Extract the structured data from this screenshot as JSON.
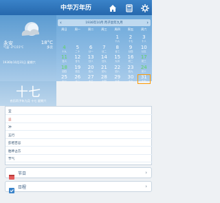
{
  "app": {
    "title": "中华万年历"
  },
  "weather": {
    "location": "永安",
    "condition": "气温 -3°C/15°C",
    "temp_high": "18°C",
    "temp_low": "多云",
    "date_line": "1936年10月31日 星期六"
  },
  "day_card": {
    "lunar_day": "十七",
    "lunar_sub": "农历丙子年九月 十七 星期六"
  },
  "calendar": {
    "header": "1936年10月 丙子鼠年九月",
    "week_labels": [
      "周日",
      "周一",
      "周二",
      "周三",
      "周四",
      "周五",
      "周六"
    ],
    "rows": [
      [
        {
          "d": "",
          "s": ""
        },
        {
          "d": "",
          "s": ""
        },
        {
          "d": "",
          "s": ""
        },
        {
          "d": "",
          "s": ""
        },
        {
          "d": "1",
          "s": "十六"
        },
        {
          "d": "2",
          "s": "十七"
        },
        {
          "d": "3",
          "s": "十八"
        }
      ],
      [
        {
          "d": "4",
          "s": "十九",
          "g": true
        },
        {
          "d": "5",
          "s": "二十"
        },
        {
          "d": "6",
          "s": "廿一"
        },
        {
          "d": "7",
          "s": "廿二"
        },
        {
          "d": "8",
          "s": "廿三"
        },
        {
          "d": "9",
          "s": "廿四"
        },
        {
          "d": "10",
          "s": "廿五"
        }
      ],
      [
        {
          "d": "11",
          "s": "廿六",
          "g": true
        },
        {
          "d": "12",
          "s": "廿七"
        },
        {
          "d": "13",
          "s": "廿八"
        },
        {
          "d": "14",
          "s": "廿九"
        },
        {
          "d": "15",
          "s": "九月"
        },
        {
          "d": "16",
          "s": "初二"
        },
        {
          "d": "17",
          "s": "初三",
          "g": true
        }
      ],
      [
        {
          "d": "18",
          "s": "初四",
          "g": true
        },
        {
          "d": "19",
          "s": "初五"
        },
        {
          "d": "20",
          "s": "初六"
        },
        {
          "d": "21",
          "s": "初七"
        },
        {
          "d": "22",
          "s": "初八"
        },
        {
          "d": "23",
          "s": "初九"
        },
        {
          "d": "24",
          "s": "初十",
          "g": true
        }
      ],
      [
        {
          "d": "25",
          "s": "十一"
        },
        {
          "d": "26",
          "s": "十二"
        },
        {
          "d": "27",
          "s": "十三"
        },
        {
          "d": "28",
          "s": "十四"
        },
        {
          "d": "29",
          "s": "十五"
        },
        {
          "d": "30",
          "s": "十六"
        },
        {
          "d": "31",
          "s": "十七",
          "sel": true
        }
      ]
    ]
  },
  "details": {
    "rows": [
      {
        "label": "宜",
        "value": ""
      },
      {
        "label": "忌",
        "value": ""
      },
      {
        "label": "冲",
        "value": ""
      },
      {
        "label": "五行",
        "value": ""
      },
      {
        "label": "彭祖百忌",
        "value": ""
      },
      {
        "label": "胎神占方",
        "value": ""
      },
      {
        "label": "节气",
        "value": ""
      }
    ]
  },
  "sections": [
    {
      "label": "节日",
      "icon": "festival-icon"
    },
    {
      "label": "日程",
      "icon": "schedule-icon"
    }
  ],
  "colors": {
    "topbar": "#2e74bb",
    "accent": "#ff9a00"
  }
}
